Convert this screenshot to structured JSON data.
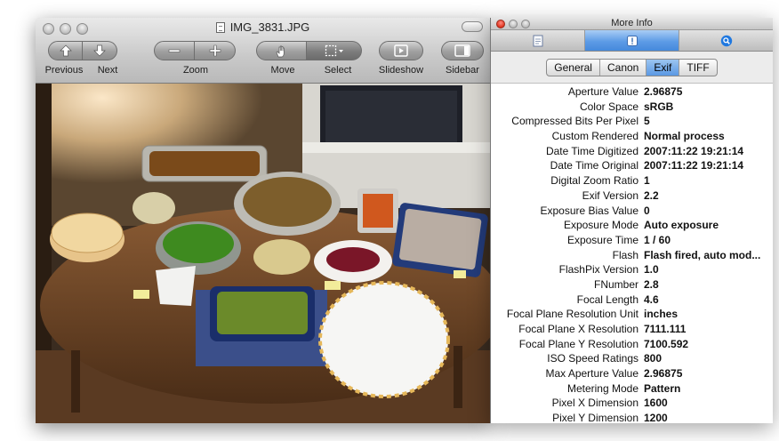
{
  "preview": {
    "title": "IMG_3831.JPG",
    "toolbar": {
      "previous": "Previous",
      "next": "Next",
      "zoom": "Zoom",
      "move": "Move",
      "select": "Select",
      "slideshow": "Slideshow",
      "sidebar": "Sidebar"
    }
  },
  "info": {
    "title": "More Info",
    "tabs": [
      "General",
      "Canon",
      "Exif",
      "TIFF"
    ],
    "active_tab": "Exif",
    "rows": [
      {
        "key": "Aperture Value",
        "value": "2.96875"
      },
      {
        "key": "Color Space",
        "value": "sRGB"
      },
      {
        "key": "Compressed Bits Per Pixel",
        "value": "5"
      },
      {
        "key": "Custom Rendered",
        "value": "Normal process"
      },
      {
        "key": "Date Time Digitized",
        "value": "2007:11:22 19:21:14"
      },
      {
        "key": "Date Time Original",
        "value": "2007:11:22 19:21:14"
      },
      {
        "key": "Digital Zoom Ratio",
        "value": "1"
      },
      {
        "key": "Exif Version",
        "value": "2.2"
      },
      {
        "key": "Exposure Bias Value",
        "value": "0"
      },
      {
        "key": "Exposure Mode",
        "value": "Auto exposure"
      },
      {
        "key": "Exposure Time",
        "value": "1 / 60"
      },
      {
        "key": "Flash",
        "value": "Flash fired, auto mod..."
      },
      {
        "key": "FlashPix Version",
        "value": "1.0"
      },
      {
        "key": "FNumber",
        "value": "2.8"
      },
      {
        "key": "Focal Length",
        "value": "4.6"
      },
      {
        "key": "Focal Plane Resolution Unit",
        "value": "inches"
      },
      {
        "key": "Focal Plane X Resolution",
        "value": "7111.111"
      },
      {
        "key": "Focal Plane Y Resolution",
        "value": "7100.592"
      },
      {
        "key": "ISO Speed Ratings",
        "value": "800"
      },
      {
        "key": "Max Aperture Value",
        "value": "2.96875"
      },
      {
        "key": "Metering Mode",
        "value": "Pattern"
      },
      {
        "key": "Pixel X Dimension",
        "value": "1600"
      },
      {
        "key": "Pixel Y Dimension",
        "value": "1200"
      }
    ]
  },
  "colors": {
    "accent": "#5d9be6",
    "toolbar": "#c9c9c9"
  }
}
